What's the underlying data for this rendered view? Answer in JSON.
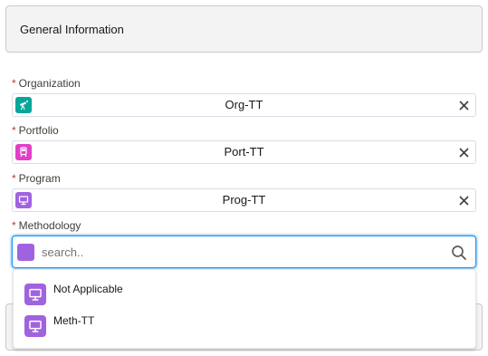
{
  "section": {
    "title": "General Information"
  },
  "required_marker": "*",
  "fields": [
    {
      "label": "Organization",
      "value": "Org-TT",
      "icon": "telescope-icon",
      "icon_color": "#06a59a"
    },
    {
      "label": "Portfolio",
      "value": "Port-TT",
      "icon": "tram-icon",
      "icon_color": "#e040c6"
    },
    {
      "label": "Program",
      "value": "Prog-TT",
      "icon": "monitor-icon",
      "icon_color": "#a063e0"
    }
  ],
  "methodology": {
    "label": "Methodology",
    "placeholder": "search..",
    "icon_color": "#a063e0",
    "options": [
      {
        "label": "Not Applicable",
        "icon": "monitor-icon"
      },
      {
        "label": "Meth-TT",
        "icon": "monitor-icon"
      }
    ]
  }
}
